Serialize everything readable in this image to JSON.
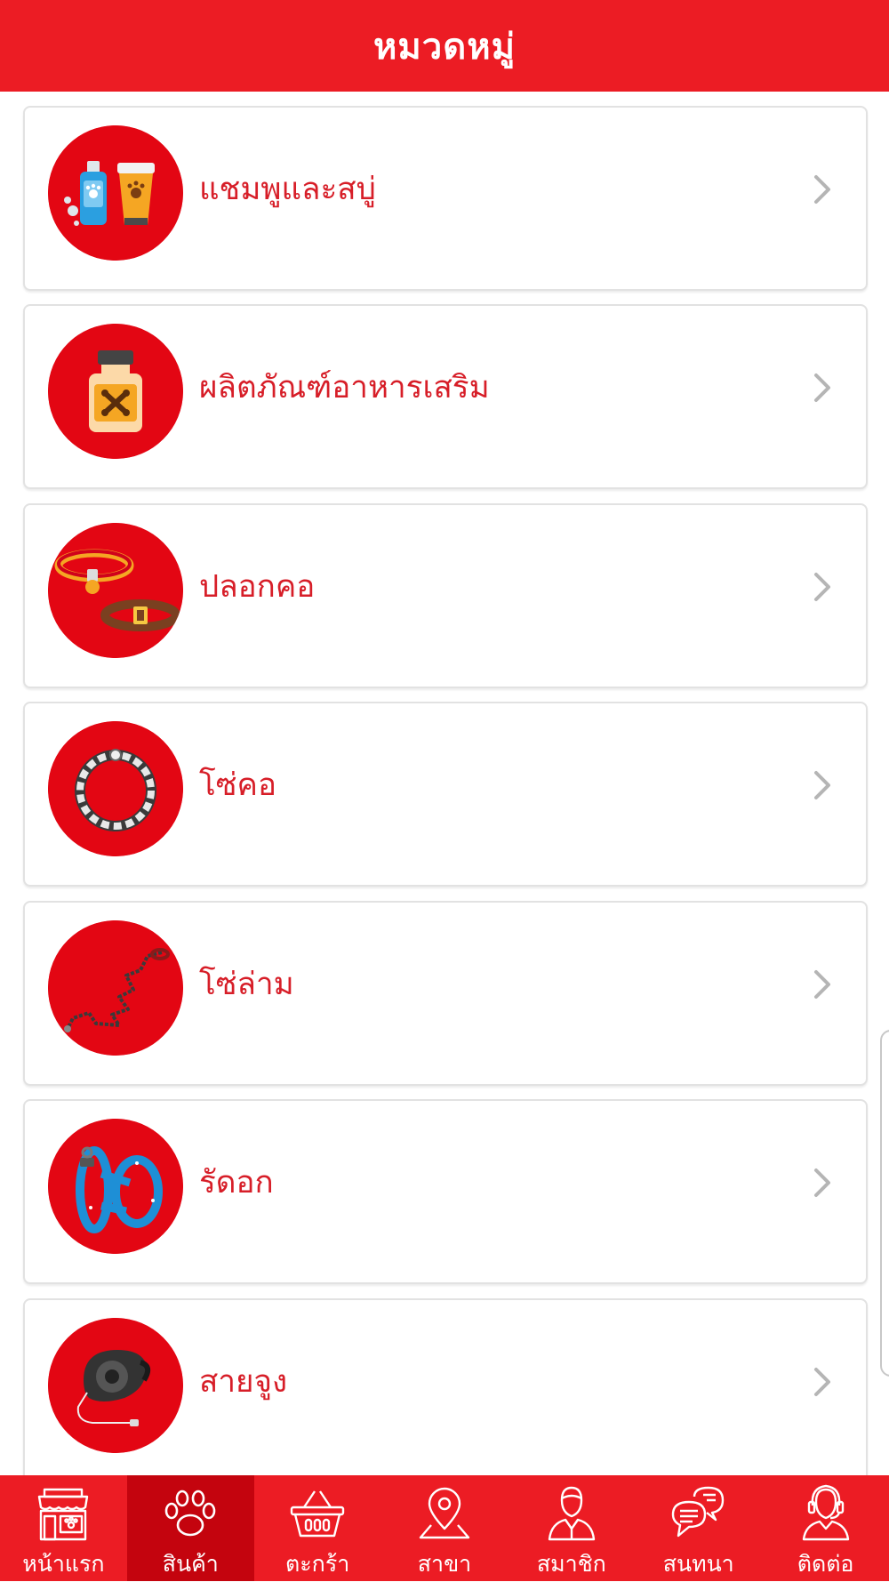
{
  "header": {
    "title": "หมวดหมู่"
  },
  "categories": [
    {
      "label": "แชมพูและสบู่",
      "icon": "shampoo-soap-icon"
    },
    {
      "label": "ผลิตภัณฑ์อาหารเสริม",
      "icon": "supplement-bottle-icon"
    },
    {
      "label": "ปลอกคอ",
      "icon": "pet-collar-icon"
    },
    {
      "label": "โซ่คอ",
      "icon": "chain-collar-icon"
    },
    {
      "label": "โซ่ล่าม",
      "icon": "chain-leash-icon"
    },
    {
      "label": "รัดอก",
      "icon": "harness-icon"
    },
    {
      "label": "สายจูง",
      "icon": "retractable-leash-icon"
    }
  ],
  "nav": [
    {
      "label": "หน้าแรก",
      "icon": "storefront-icon",
      "active": false
    },
    {
      "label": "สินค้า",
      "icon": "paw-icon",
      "active": true
    },
    {
      "label": "ตะกร้า",
      "icon": "basket-icon",
      "active": false
    },
    {
      "label": "สาขา",
      "icon": "location-pin-icon",
      "active": false
    },
    {
      "label": "สมาชิก",
      "icon": "member-icon",
      "active": false
    },
    {
      "label": "สนทนา",
      "icon": "chat-icon",
      "active": false
    },
    {
      "label": "ติดต่อ",
      "icon": "support-agent-icon",
      "active": false
    }
  ],
  "colors": {
    "brand_red": "#ec1c24",
    "active_tab": "#c4040e",
    "label_red": "#d71e28",
    "icon_circle": "#e30613"
  }
}
